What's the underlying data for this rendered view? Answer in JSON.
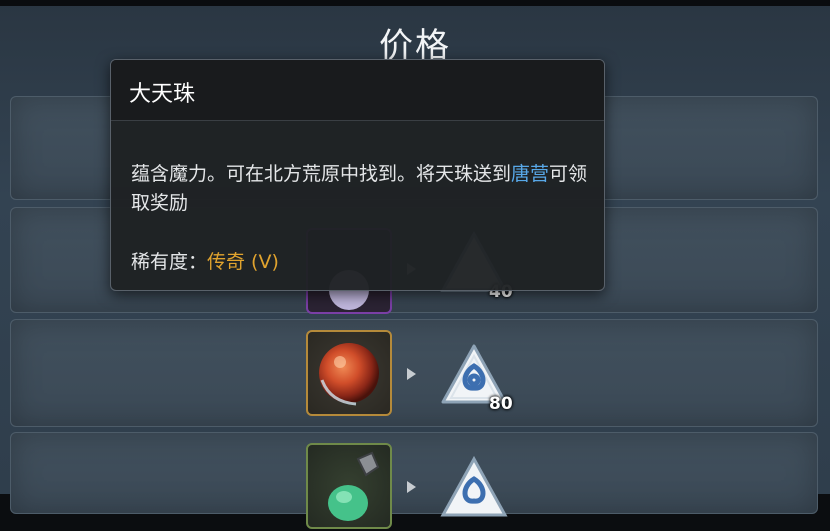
{
  "heading": "价格",
  "tooltip": {
    "title": "大天珠",
    "desc_part1": "蕴含魔力。可在北方荒原中找到。将天珠送到",
    "desc_link": "唐营",
    "desc_part2": "可领取奖励",
    "rarity_label": "稀有度：",
    "rarity_value": "传奇 (V)"
  },
  "rows": [
    {
      "item_icon": "purple-orb-icon",
      "currency_icon": "triskelion-token-icon",
      "price": "40"
    },
    {
      "item_icon": "red-orb-icon",
      "currency_icon": "triskelion-token-icon",
      "price": "80"
    },
    {
      "item_icon": "green-potion-icon",
      "currency_icon": "triskelion-token-icon"
    }
  ],
  "colors": {
    "accent_link": "#58a8e8",
    "rarity_legendary": "#e0a32e",
    "frame_gold": "#b58a3a"
  }
}
